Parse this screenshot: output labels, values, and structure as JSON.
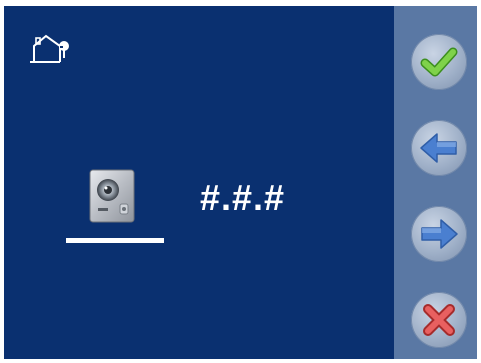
{
  "display": {
    "code": "#.#.#"
  },
  "icons": {
    "home": "home-icon",
    "device": "door-panel-icon",
    "confirm": "checkmark-icon",
    "previous": "arrow-left-icon",
    "next": "arrow-right-icon",
    "cancel": "close-icon"
  },
  "colors": {
    "background": "#0a3070",
    "sidebar": "#5a78a4",
    "confirm": "#6ac13b",
    "arrows": "#4a7fd0",
    "cancel": "#d94a4a"
  }
}
